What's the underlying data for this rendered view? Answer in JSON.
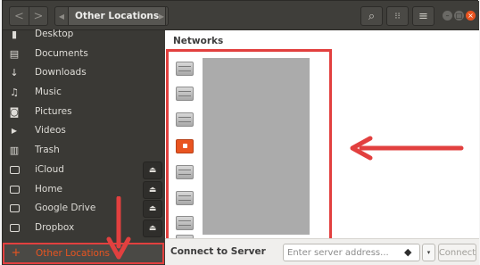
{
  "header": {
    "back_glyph": "<",
    "forward_glyph": ">",
    "path_left_glyph": "◀",
    "path_right_glyph": "▶",
    "location_label": "Other Locations",
    "search_glyph": "⌕",
    "view_glyph": "⁝⁝",
    "menu_glyph": "≡",
    "minimize_glyph": "–",
    "maximize_glyph": "□",
    "close_glyph": "×"
  },
  "sidebar": {
    "items": [
      {
        "label": "Desktop",
        "icon": "desktop-icon",
        "glyph": "▮",
        "eject": false
      },
      {
        "label": "Documents",
        "icon": "document-icon",
        "glyph": "▤",
        "eject": false
      },
      {
        "label": "Downloads",
        "icon": "download-icon",
        "glyph": "↓",
        "eject": false
      },
      {
        "label": "Music",
        "icon": "music-icon",
        "glyph": "♫",
        "eject": false
      },
      {
        "label": "Pictures",
        "icon": "camera-icon",
        "glyph": "◙",
        "eject": false
      },
      {
        "label": "Videos",
        "icon": "video-icon",
        "glyph": "▶",
        "eject": false
      },
      {
        "label": "Trash",
        "icon": "trash-icon",
        "glyph": "▥",
        "eject": false
      },
      {
        "label": "iCloud",
        "icon": "drive-icon",
        "glyph": "",
        "eject": true
      },
      {
        "label": "Home",
        "icon": "drive-icon",
        "glyph": "",
        "eject": true
      },
      {
        "label": "Google Drive",
        "icon": "drive-icon",
        "glyph": "",
        "eject": true
      },
      {
        "label": "Dropbox",
        "icon": "drive-icon",
        "glyph": "",
        "eject": true
      }
    ],
    "other_locations": {
      "label": "Other Locations",
      "glyph": "+"
    },
    "eject_glyph": "⏏"
  },
  "main": {
    "networks_header": "Networks",
    "network_items": [
      {
        "icon": "network-server-icon"
      },
      {
        "icon": "network-server-icon"
      },
      {
        "icon": "network-server-icon"
      },
      {
        "icon": "network-share-icon"
      },
      {
        "icon": "network-server-icon"
      },
      {
        "icon": "network-server-icon"
      },
      {
        "icon": "network-server-icon"
      },
      {
        "icon": "network-server-icon"
      }
    ]
  },
  "bottom": {
    "connect_label": "Connect to Server",
    "server_placeholder": "Enter server address...",
    "server_value": "",
    "help_glyph": "◆",
    "dropdown_glyph": "▾",
    "connect_button": "Connect"
  },
  "colors": {
    "accent": "#e95420",
    "annotation": "#e2403f",
    "sidebar_bg": "#3a3935",
    "header_bg": "#3f3e3a"
  }
}
